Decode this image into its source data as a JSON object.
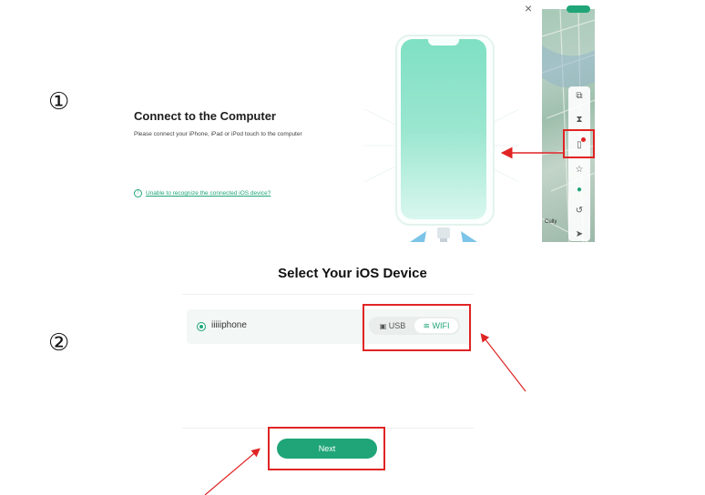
{
  "step_markers": {
    "one": "①",
    "two": "②"
  },
  "connect_panel": {
    "title": "Connect to the Computer",
    "description": "Please connect your iPhone, iPad or iPod touch to the computer",
    "help_icon": "info-circle-icon",
    "help_link": "Unable to recognize the connected iOS device?",
    "close_label": "×"
  },
  "map_panel": {
    "tool_icons": [
      "device-icon",
      "hourglass-icon",
      "phone-icon",
      "star-icon",
      "globe-icon",
      "history-icon",
      "cursor-arrow-icon"
    ],
    "place_label": "Cully"
  },
  "device_panel": {
    "title": "Select Your iOS Device",
    "device_name": "iiiiiphone",
    "usb_label": "USB",
    "wifi_label": "WIFI",
    "next_label": "Next"
  },
  "colors": {
    "accent": "#1fa577",
    "highlight": "#e02424",
    "phone_screen": "#7fe0c3"
  }
}
